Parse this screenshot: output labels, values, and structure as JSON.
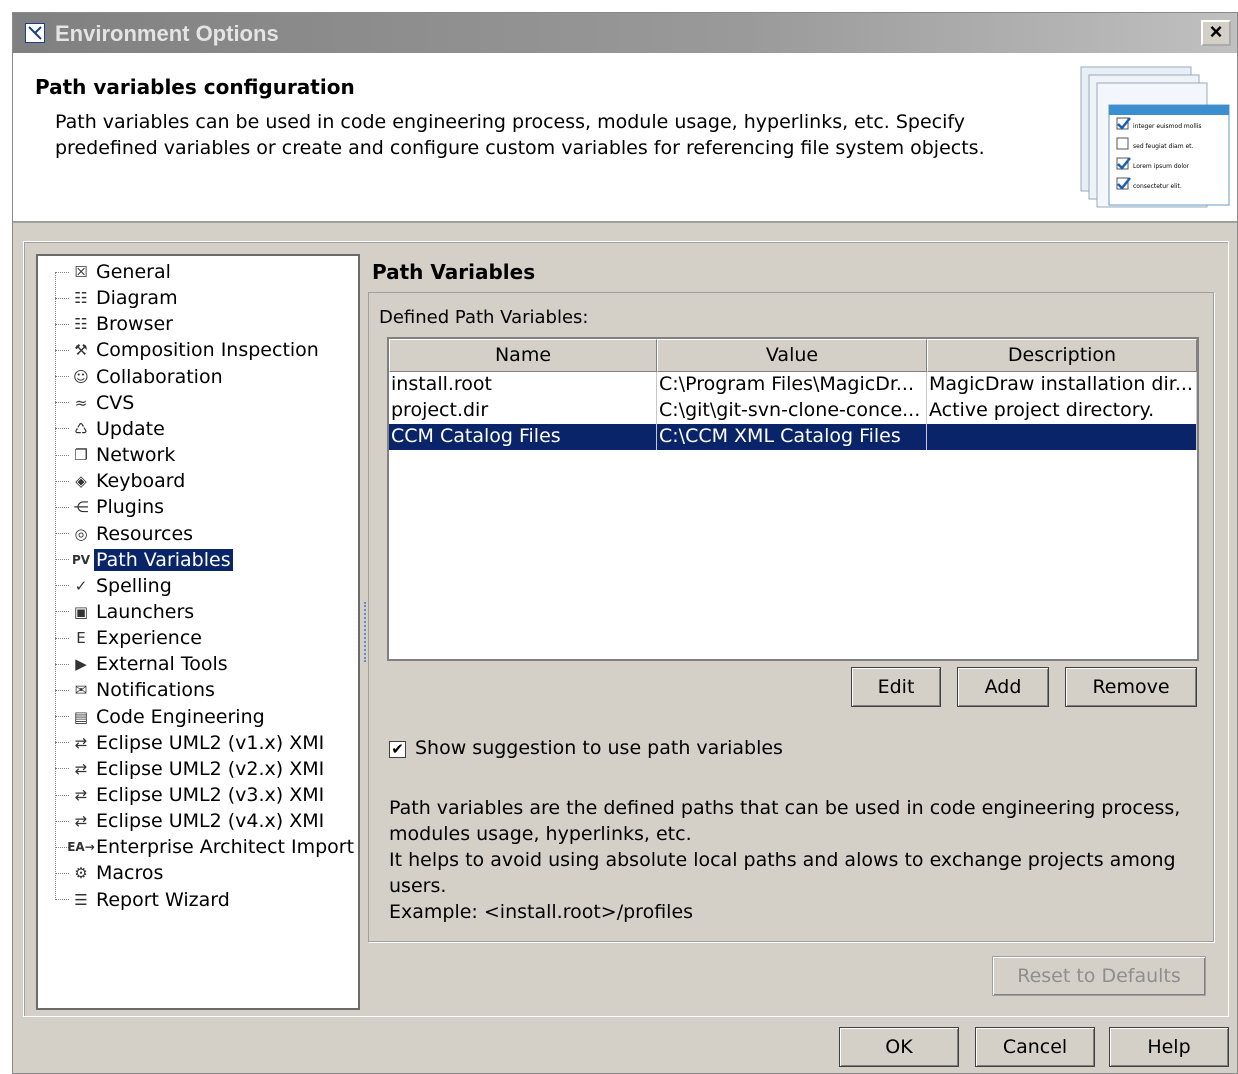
{
  "window": {
    "title": "Environment Options",
    "close_label": "×"
  },
  "header": {
    "title": "Path variables configuration",
    "description": "Path variables can be used in code engineering process, module usage, hyperlinks, etc. Specify predefined variables or create and configure custom variables for referencing file system objects."
  },
  "tree": {
    "items": [
      {
        "label": "General",
        "icon": "general-icon",
        "glyph": "☒"
      },
      {
        "label": "Diagram",
        "icon": "diagram-icon",
        "glyph": "☷"
      },
      {
        "label": "Browser",
        "icon": "browser-icon",
        "glyph": "☷"
      },
      {
        "label": "Composition Inspection",
        "icon": "composition-inspection-icon",
        "glyph": "⚒"
      },
      {
        "label": "Collaboration",
        "icon": "collaboration-icon",
        "glyph": "☺"
      },
      {
        "label": "CVS",
        "icon": "cvs-icon",
        "glyph": "≈"
      },
      {
        "label": "Update",
        "icon": "update-icon",
        "glyph": "♺"
      },
      {
        "label": "Network",
        "icon": "network-icon",
        "glyph": "❐"
      },
      {
        "label": "Keyboard",
        "icon": "keyboard-icon",
        "glyph": "◈"
      },
      {
        "label": "Plugins",
        "icon": "plugins-icon",
        "glyph": "⋲"
      },
      {
        "label": "Resources",
        "icon": "resources-icon",
        "glyph": "◎"
      },
      {
        "label": "Path Variables",
        "icon": "path-variables-icon",
        "glyph": "PV"
      },
      {
        "label": "Spelling",
        "icon": "spelling-icon",
        "glyph": "✓"
      },
      {
        "label": "Launchers",
        "icon": "launchers-icon",
        "glyph": "▣"
      },
      {
        "label": "Experience",
        "icon": "experience-icon",
        "glyph": "E"
      },
      {
        "label": "External Tools",
        "icon": "external-tools-icon",
        "glyph": "▶"
      },
      {
        "label": "Notifications",
        "icon": "notifications-icon",
        "glyph": "✉"
      },
      {
        "label": "Code Engineering",
        "icon": "code-engineering-icon",
        "glyph": "▤"
      },
      {
        "label": "Eclipse UML2 (v1.x) XMI",
        "icon": "xmi-icon",
        "glyph": "⇄"
      },
      {
        "label": "Eclipse UML2 (v2.x) XMI",
        "icon": "xmi-icon",
        "glyph": "⇄"
      },
      {
        "label": "Eclipse UML2 (v3.x) XMI",
        "icon": "xmi-icon",
        "glyph": "⇄"
      },
      {
        "label": "Eclipse UML2 (v4.x) XMI",
        "icon": "xmi-icon",
        "glyph": "⇄"
      },
      {
        "label": "Enterprise Architect Import",
        "icon": "ea-import-icon",
        "glyph": "EA→"
      },
      {
        "label": "Macros",
        "icon": "macros-icon",
        "glyph": "⚙"
      },
      {
        "label": "Report Wizard",
        "icon": "report-wizard-icon",
        "glyph": "☰"
      }
    ],
    "selected_index": 11
  },
  "main": {
    "section_title": "Path Variables",
    "group_label": "Defined Path Variables:",
    "table": {
      "columns": [
        "Name",
        "Value",
        "Description"
      ],
      "rows": [
        [
          "install.root",
          "C:\\Program Files\\MagicDr...",
          "MagicDraw installation dir..."
        ],
        [
          "project.dir",
          "C:\\git\\git-svn-clone-conce...",
          "Active project directory."
        ],
        [
          "CCM Catalog Files",
          "C:\\CCM XML Catalog Files",
          ""
        ]
      ],
      "selected_row": 2
    },
    "buttons": {
      "edit": "Edit",
      "add": "Add",
      "remove": "Remove"
    },
    "checkbox": {
      "label": "Show suggestion to use path variables",
      "checked": true,
      "glyph": "✔"
    },
    "info_lines": [
      "Path variables are the defined paths that can be used in code engineering process,",
      "modules usage, hyperlinks, etc.",
      "It helps to avoid using absolute local paths and alows to exchange projects among",
      "users.",
      "Example: <install.root>/profiles"
    ],
    "reset_label": "Reset to Defaults"
  },
  "footer": {
    "ok": "OK",
    "cancel": "Cancel",
    "help": "Help"
  },
  "illustration": {
    "rows": [
      {
        "text": "integer euismod mollis",
        "checked": true
      },
      {
        "text": "sed feugiat diam et.",
        "checked": false
      },
      {
        "text": "Lorem ipsum dolor",
        "checked": true
      },
      {
        "text": "consectetur elit.",
        "checked": true
      }
    ]
  }
}
